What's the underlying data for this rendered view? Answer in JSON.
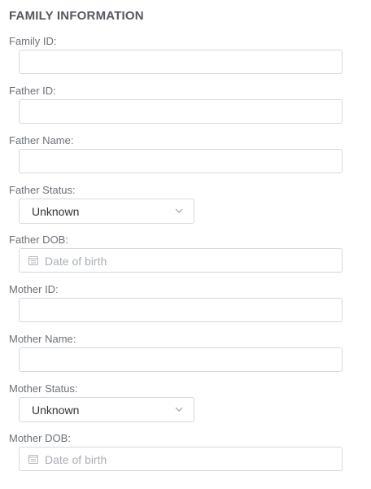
{
  "section_title": "FAMILY INFORMATION",
  "fields": {
    "family_id": {
      "label": "Family ID:",
      "value": ""
    },
    "father_id": {
      "label": "Father ID:",
      "value": ""
    },
    "father_name": {
      "label": "Father Name:",
      "value": ""
    },
    "father_status": {
      "label": "Father Status:",
      "selected": "Unknown"
    },
    "father_dob": {
      "label": "Father DOB:",
      "placeholder": "Date of birth"
    },
    "mother_id": {
      "label": "Mother ID:",
      "value": ""
    },
    "mother_name": {
      "label": "Mother Name:",
      "value": ""
    },
    "mother_status": {
      "label": "Mother Status:",
      "selected": "Unknown"
    },
    "mother_dob": {
      "label": "Mother DOB:",
      "placeholder": "Date of birth"
    }
  },
  "icons": {
    "dropdown": "chevron-down-icon",
    "date": "calendar-icon"
  },
  "colors": {
    "border": "#d5d8dc",
    "label": "#6c7177",
    "placeholder": "#a9aeb3"
  }
}
